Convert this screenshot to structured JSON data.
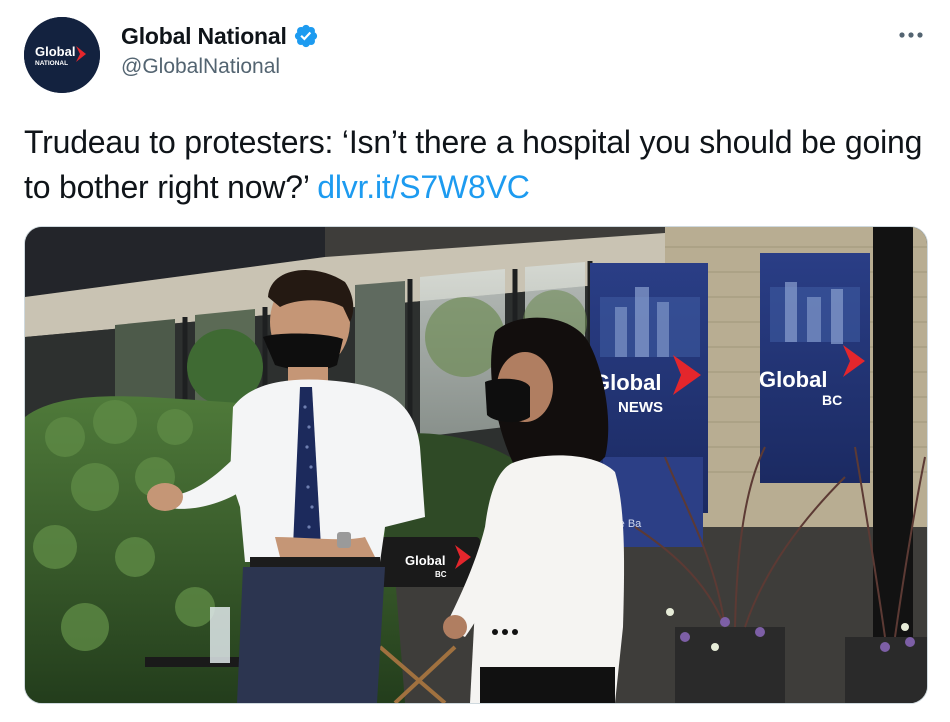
{
  "account": {
    "display_name": "Global National",
    "handle": "@GlobalNational",
    "avatar_logo_text": "Global",
    "avatar_logo_subtext": "NATIONAL",
    "verified": true
  },
  "tweet": {
    "text": "Trudeau to protesters: ‘Isn’t there a hospital you should be going to bother right now?’",
    "link_text": "dlvr.it/S7W8VC"
  },
  "media": {
    "sign_left_title": "Global",
    "sign_left_subtitle": "NEWS",
    "sign_right_title": "Global",
    "sign_right_subtitle": "BC",
    "chair_title": "Global",
    "chair_subtitle": "BC",
    "banner_partial_text": "re Ba"
  },
  "colors": {
    "link": "#1d9bf0",
    "verified": "#1d9bf0",
    "text": "#0f1419",
    "secondary": "#536471",
    "brand_red": "#e4262c",
    "brand_navy": "#13223f"
  },
  "icons": {
    "verified": "verified-badge-icon",
    "more": "more-dots-icon"
  }
}
